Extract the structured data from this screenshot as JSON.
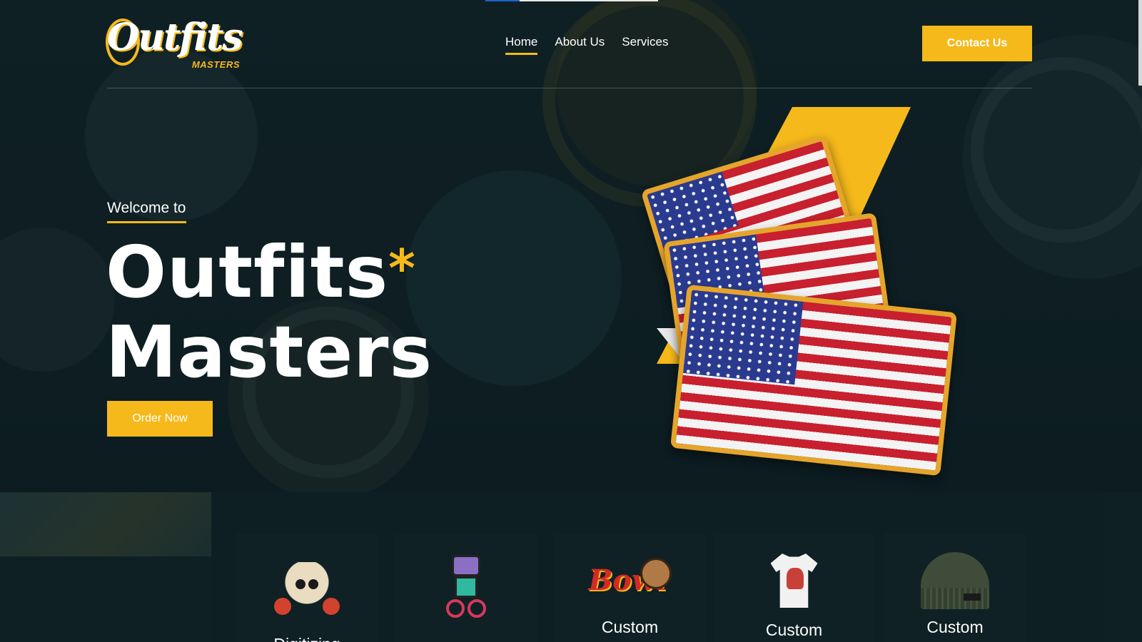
{
  "header": {
    "logo_main": "Outfits",
    "logo_sub": "MASTERS",
    "nav": [
      {
        "label": "Home",
        "active": true
      },
      {
        "label": "About Us",
        "active": false
      },
      {
        "label": "Services",
        "active": false
      }
    ],
    "contact_label": "Contact Us"
  },
  "hero": {
    "welcome": "Welcome to",
    "title_line1": "Outfits",
    "title_star": "*",
    "title_line2": "Masters",
    "order_label": "Order Now"
  },
  "services": [
    {
      "label": "Digitizing",
      "icon": "skull-roses-icon"
    },
    {
      "label": "",
      "icon": "robot-bike-icon"
    },
    {
      "label": "Custom",
      "icon": "bowl-bear-icon"
    },
    {
      "label": "Custom",
      "icon": "tshirt-icon"
    },
    {
      "label": "Custom",
      "icon": "beanie-icon"
    }
  ],
  "colors": {
    "accent": "#f6b91b",
    "background": "#0f2024",
    "text": "#ffffff"
  }
}
